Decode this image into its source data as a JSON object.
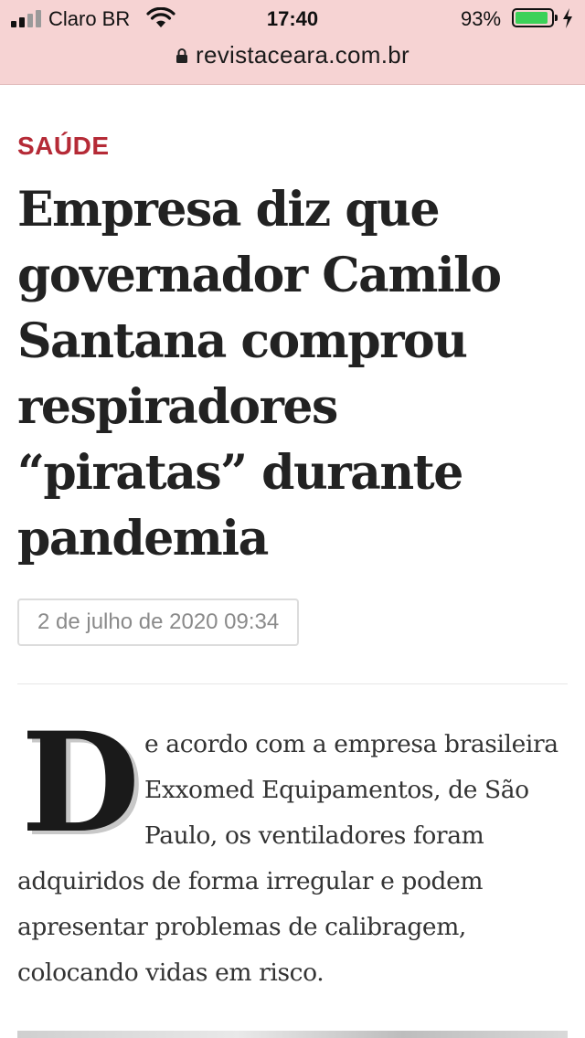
{
  "status_bar": {
    "carrier": "Claro BR",
    "time": "17:40",
    "battery_percent": "93%",
    "battery_level": 0.93,
    "signal_bars": 2
  },
  "address_bar": {
    "url": "revistaceara.com.br",
    "lock_icon": "lock-icon"
  },
  "article": {
    "category": "SAÚDE",
    "headline": "Empresa diz que governador Camilo Santana comprou respiradores “piratas” durante pandemia",
    "date": "2 de julho de 2020 09:34",
    "drop_cap": "D",
    "body": "e acordo com a empresa brasileira Exxomed Equipamentos, de São Paulo, os ventiladores foram adquiridos de forma irregular e podem apresentar problemas de calibragem, colocando vidas em risco."
  },
  "colors": {
    "chrome_bg": "#f6d3d3",
    "category": "#b52a36",
    "battery_fill": "#3bd158"
  }
}
